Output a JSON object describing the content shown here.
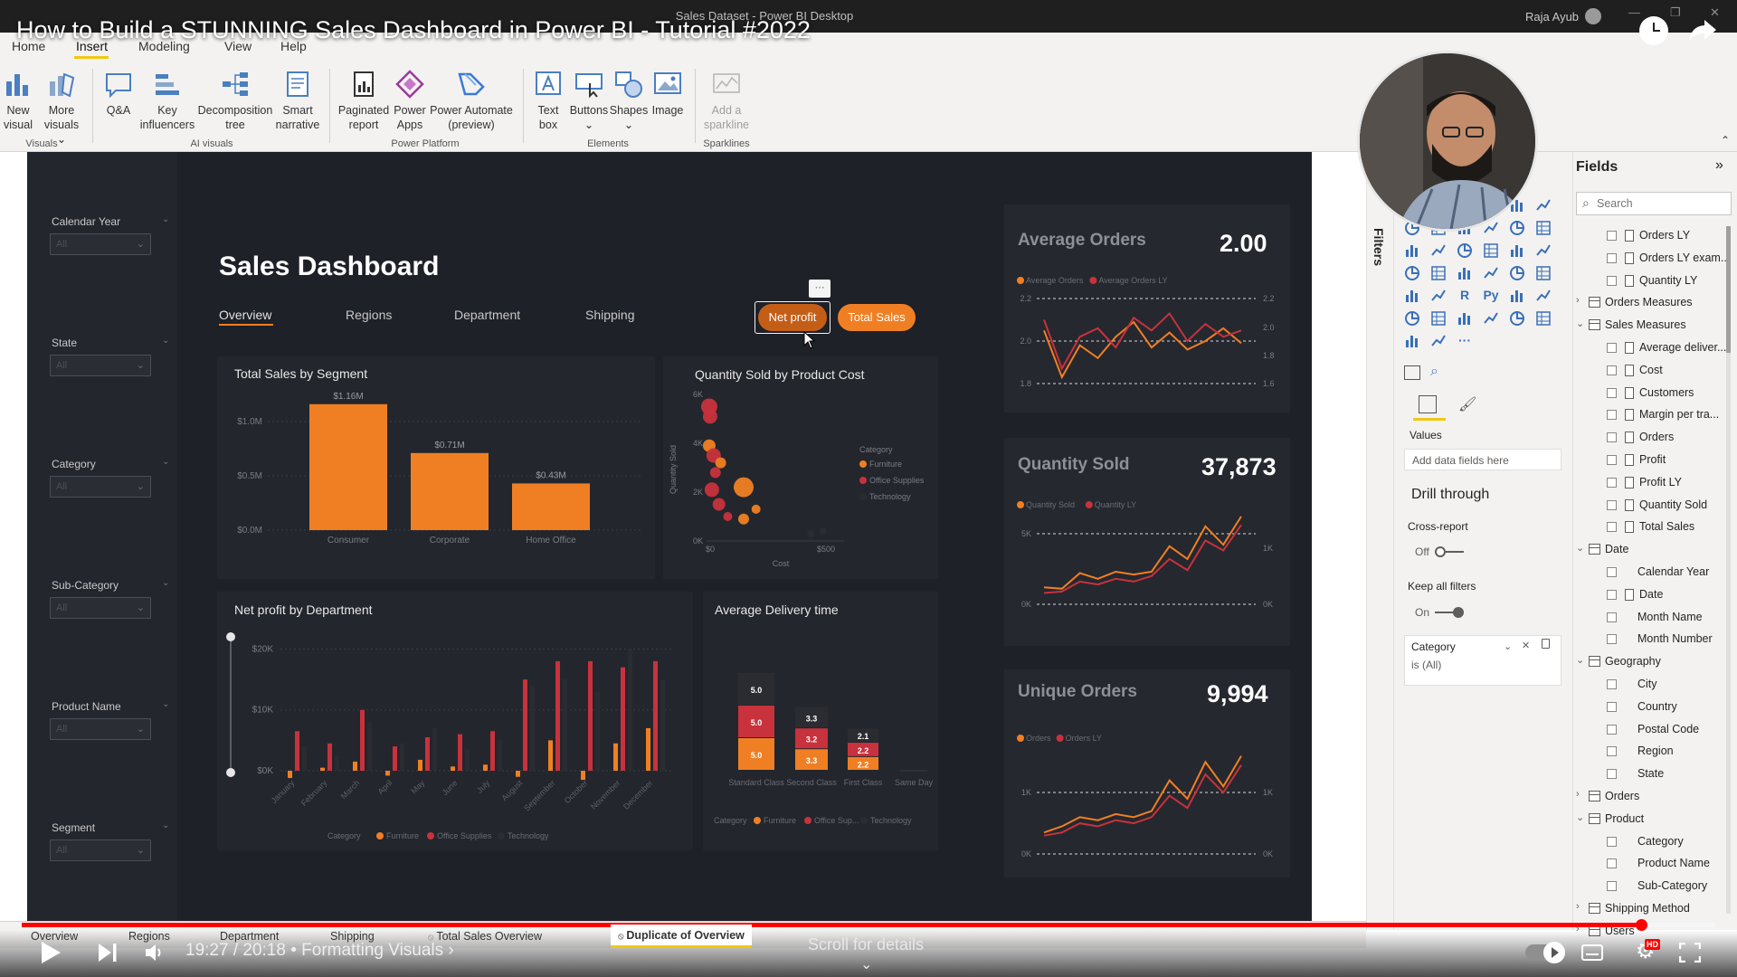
{
  "video": {
    "title": "How to Build a STUNNING Sales Dashboard in Power BI - Tutorial #2022",
    "time": "19:27 / 20:18",
    "chapter": "• Formatting Visuals",
    "chapter_arrow": "›",
    "scroll_hint": "Scroll for details",
    "hd_badge": "HD",
    "progress_fraction": 0.956
  },
  "window": {
    "title": "Sales Dataset - Power BI Desktop",
    "user": "Raja Ayub"
  },
  "ribbon": {
    "tabs": [
      "Home",
      "Insert",
      "Modeling",
      "View",
      "Help"
    ],
    "buttons": {
      "new_visual": [
        "New",
        "visual"
      ],
      "more_visuals": [
        "More",
        "visuals ⌄"
      ],
      "qa": [
        "Q&A",
        ""
      ],
      "key_influencers": [
        "Key",
        "influencers"
      ],
      "decomposition_tree": [
        "Decomposition",
        "tree"
      ],
      "smart_narrative": [
        "Smart",
        "narrative"
      ],
      "paginated_report": [
        "Paginated",
        "report"
      ],
      "power_apps": [
        "Power",
        "Apps"
      ],
      "power_automate": [
        "Power Automate",
        "(preview)"
      ],
      "text_box": [
        "Text",
        "box"
      ],
      "buttons": [
        "Buttons",
        "⌄"
      ],
      "shapes": [
        "Shapes",
        "⌄"
      ],
      "image": [
        "Image",
        ""
      ],
      "add_sparkline": [
        "Add a",
        "sparkline"
      ]
    },
    "groups": [
      "Visuals",
      "AI visuals",
      "Power Platform",
      "Elements",
      "Sparklines"
    ]
  },
  "slicers": [
    {
      "label": "Calendar Year",
      "value": "All"
    },
    {
      "label": "State",
      "value": "All"
    },
    {
      "label": "Category",
      "value": "All"
    },
    {
      "label": "Sub-Category",
      "value": "All"
    },
    {
      "label": "Product Name",
      "value": "All"
    },
    {
      "label": "Segment",
      "value": "All"
    }
  ],
  "dashboard": {
    "title": "Sales Dashboard",
    "nav": [
      "Overview",
      "Regions",
      "Department",
      "Shipping"
    ],
    "toggle_buttons": [
      "Net profit",
      "Total Sales"
    ],
    "more_options": "···"
  },
  "colors": {
    "accent": "#f07f23",
    "furniture": "#f07f23",
    "office_supplies": "#c8323c",
    "technology": "#2a2c31",
    "report_bg": "#1e2128",
    "card_bg": "#23262d",
    "powerbi_yellow": "#f2c811"
  },
  "chart_data": [
    {
      "id": "segment",
      "type": "bar",
      "title": "Total Sales by Segment",
      "categories": [
        "Consumer",
        "Corporate",
        "Home Office"
      ],
      "values": [
        1.16,
        0.71,
        0.43
      ],
      "data_labels": [
        "$1.16M",
        "$0.71M",
        "$0.43M"
      ],
      "y_ticks": [
        "$0.0M",
        "$0.5M",
        "$1.0M"
      ],
      "ylim": [
        0,
        1.2
      ]
    },
    {
      "id": "qty_cost",
      "type": "scatter",
      "title": "Quantity Sold by Product Cost",
      "ylabel": "Quantity Sold",
      "xlabel": "Cost",
      "x_ticks": [
        "$0",
        "$500"
      ],
      "y_ticks": [
        "0K",
        "2K",
        "4K",
        "6K"
      ],
      "xlim": [
        0,
        1000
      ],
      "ylim": [
        0,
        6
      ],
      "legend_title": "Category",
      "legend": [
        "Furniture",
        "Office Supplies",
        "Technology"
      ],
      "points": [
        {
          "x": 15,
          "y": 5.5,
          "s": 9,
          "cat": "Office Supplies"
        },
        {
          "x": 20,
          "y": 5.1,
          "s": 8,
          "cat": "Office Supplies"
        },
        {
          "x": 15,
          "y": 3.9,
          "s": 7,
          "cat": "Furniture"
        },
        {
          "x": 40,
          "y": 3.5,
          "s": 8,
          "cat": "Office Supplies"
        },
        {
          "x": 80,
          "y": 3.2,
          "s": 6,
          "cat": "Furniture"
        },
        {
          "x": 50,
          "y": 2.8,
          "s": 6,
          "cat": "Office Supplies"
        },
        {
          "x": 210,
          "y": 2.2,
          "s": 11,
          "cat": "Furniture"
        },
        {
          "x": 30,
          "y": 2.1,
          "s": 8,
          "cat": "Office Supplies"
        },
        {
          "x": 70,
          "y": 1.5,
          "s": 7,
          "cat": "Office Supplies"
        },
        {
          "x": 120,
          "y": 1.0,
          "s": 5,
          "cat": "Office Supplies"
        },
        {
          "x": 280,
          "y": 1.3,
          "s": 5,
          "cat": "Furniture"
        },
        {
          "x": 210,
          "y": 0.9,
          "s": 6,
          "cat": "Furniture"
        },
        {
          "x": 590,
          "y": 0.3,
          "s": 4,
          "cat": "Technology"
        },
        {
          "x": 660,
          "y": 0.4,
          "s": 4,
          "cat": "Technology"
        }
      ]
    },
    {
      "id": "dept",
      "type": "bar",
      "title": "Net profit by Department",
      "categories": [
        "January",
        "February",
        "March",
        "April",
        "May",
        "June",
        "July",
        "August",
        "September",
        "October",
        "November",
        "December"
      ],
      "y_ticks": [
        "$0K",
        "$10K",
        "$20K"
      ],
      "ylim": [
        0,
        22
      ],
      "legend_title": "Category",
      "legend": [
        "Furniture",
        "Office Supplies",
        "Technology"
      ],
      "series": [
        {
          "name": "Furniture",
          "values": [
            -1.2,
            0.5,
            1.5,
            -0.8,
            1.8,
            0.7,
            1.0,
            -1.0,
            5.0,
            -1.5,
            4.5,
            7.0
          ]
        },
        {
          "name": "Office Supplies",
          "values": [
            6.5,
            4.5,
            10.0,
            4.0,
            5.5,
            6.0,
            6.5,
            15.0,
            18.0,
            18.0,
            17.0,
            18.0
          ]
        },
        {
          "name": "Technology",
          "values": [
            4.0,
            2.5,
            8.0,
            4.5,
            7.0,
            3.5,
            5.0,
            14.0,
            15.0,
            13.0,
            20.0,
            15.0
          ]
        }
      ]
    },
    {
      "id": "delivery",
      "type": "bar",
      "title": "Average Delivery time",
      "categories": [
        "Standard Class",
        "Second Class",
        "First Class",
        "Same Day"
      ],
      "legend_title": "Category",
      "legend": [
        "Furniture",
        "Office Sup...",
        "Technology"
      ],
      "series": [
        {
          "name": "Furniture",
          "values": [
            5.0,
            3.3,
            2.1,
            0
          ]
        },
        {
          "name": "Office Sup...",
          "values": [
            5.0,
            3.2,
            2.2,
            0
          ]
        },
        {
          "name": "Technology",
          "values": [
            5.0,
            3.3,
            2.2,
            0
          ]
        }
      ],
      "data_labels": [
        [
          "5.0",
          "5.0",
          "5.0"
        ],
        [
          "3.3",
          "3.2",
          "3.3"
        ],
        [
          "2.1",
          "2.2",
          "2.2"
        ],
        [
          "",
          "",
          ""
        ]
      ]
    },
    {
      "id": "avg_orders",
      "type": "line",
      "title": "Average Orders",
      "kpi": "2.00",
      "legend": [
        "Average Orders",
        "Average Orders LY"
      ],
      "y_ticks": [
        "1.8",
        "2.0",
        "2.2"
      ],
      "y2_ticks": [
        "1.6",
        "1.8",
        "2.0",
        "2.2"
      ],
      "ylim": [
        1.8,
        2.2
      ],
      "series": [
        {
          "name": "Average Orders",
          "values": [
            2.05,
            1.83,
            1.98,
            1.92,
            2.02,
            2.09,
            1.97,
            2.04,
            1.96,
            2.0,
            2.06,
            1.99
          ]
        },
        {
          "name": "Average Orders LY",
          "values": [
            2.1,
            1.87,
            2.02,
            2.06,
            1.97,
            2.11,
            2.05,
            2.13,
            2.0,
            2.08,
            2.02,
            2.05
          ]
        }
      ]
    },
    {
      "id": "qty_sold",
      "type": "line",
      "title": "Quantity Sold",
      "kpi": "37,873",
      "legend": [
        "Quantity Sold",
        "Quantity LY"
      ],
      "y_ticks": [
        "0K",
        "5K"
      ],
      "y2_ticks": [
        "0K",
        "1K"
      ],
      "ylim": [
        0,
        6
      ],
      "series": [
        {
          "name": "Quantity Sold",
          "values": [
            1.2,
            1.1,
            2.2,
            1.8,
            2.3,
            2.1,
            2.3,
            4.1,
            3.2,
            5.5,
            4.2,
            6.2
          ]
        },
        {
          "name": "Quantity LY",
          "values": [
            0.8,
            0.9,
            1.6,
            1.4,
            1.8,
            1.6,
            2.0,
            3.2,
            2.4,
            4.5,
            3.8,
            5.6
          ]
        }
      ]
    },
    {
      "id": "unique_orders",
      "type": "line",
      "title": "Unique Orders",
      "kpi": "9,994",
      "legend": [
        "Orders",
        "Orders LY"
      ],
      "y_ticks": [
        "0K",
        "1K"
      ],
      "y2_ticks": [
        "0K",
        "1K"
      ],
      "ylim": [
        0,
        1.8
      ],
      "series": [
        {
          "name": "Orders",
          "values": [
            0.35,
            0.45,
            0.6,
            0.55,
            0.65,
            0.6,
            0.7,
            1.2,
            0.9,
            1.5,
            1.1,
            1.6
          ]
        },
        {
          "name": "Orders LY",
          "values": [
            0.3,
            0.35,
            0.5,
            0.45,
            0.55,
            0.5,
            0.6,
            0.95,
            0.75,
            1.3,
            1.0,
            1.45
          ]
        }
      ]
    }
  ],
  "filters_pane": {
    "label": "Filters"
  },
  "viz_pane": {
    "values_label": "Values",
    "add_fields": "Add data fields here",
    "drill_through": "Drill through",
    "cross_report": "Cross-report",
    "cross_report_state": "Off",
    "keep_filters": "Keep all filters",
    "keep_filters_state": "On",
    "filter_card_title": "Category",
    "filter_card_value": "is (All)",
    "icon_glyphs": [
      "R",
      "Py",
      "···"
    ]
  },
  "fields_pane": {
    "title": "Fields",
    "search_placeholder": "Search",
    "rows": [
      {
        "kind": "field",
        "icon": "calc",
        "label": "Orders LY"
      },
      {
        "kind": "field",
        "icon": "calc",
        "label": "Orders LY exam..."
      },
      {
        "kind": "field",
        "icon": "calc",
        "label": "Quantity LY"
      },
      {
        "kind": "table",
        "expanded": false,
        "label": "Orders Measures"
      },
      {
        "kind": "table",
        "expanded": true,
        "label": "Sales Measures"
      },
      {
        "kind": "field",
        "icon": "calc",
        "label": "Average deliver..."
      },
      {
        "kind": "field",
        "icon": "calc",
        "label": "Cost"
      },
      {
        "kind": "field",
        "icon": "calc",
        "label": "Customers"
      },
      {
        "kind": "field",
        "icon": "calc",
        "label": "Margin per tra..."
      },
      {
        "kind": "field",
        "icon": "calc",
        "label": "Orders"
      },
      {
        "kind": "field",
        "icon": "calc",
        "label": "Profit"
      },
      {
        "kind": "field",
        "icon": "calc",
        "label": "Profit LY"
      },
      {
        "kind": "field",
        "icon": "calc",
        "label": "Quantity Sold"
      },
      {
        "kind": "field",
        "icon": "calc",
        "label": "Total Sales"
      },
      {
        "kind": "table",
        "expanded": true,
        "label": "Date"
      },
      {
        "kind": "field",
        "icon": "none",
        "label": "Calendar Year"
      },
      {
        "kind": "field",
        "icon": "hier",
        "label": "Date"
      },
      {
        "kind": "field",
        "icon": "none",
        "label": "Month Name"
      },
      {
        "kind": "field",
        "icon": "none",
        "label": "Month Number"
      },
      {
        "kind": "table",
        "expanded": true,
        "label": "Geography"
      },
      {
        "kind": "field",
        "icon": "none",
        "label": "City"
      },
      {
        "kind": "field",
        "icon": "none",
        "label": "Country"
      },
      {
        "kind": "field",
        "icon": "none",
        "label": "Postal Code"
      },
      {
        "kind": "field",
        "icon": "none",
        "label": "Region"
      },
      {
        "kind": "field",
        "icon": "none",
        "label": "State"
      },
      {
        "kind": "table",
        "expanded": false,
        "label": "Orders"
      },
      {
        "kind": "table",
        "expanded": true,
        "label": "Product"
      },
      {
        "kind": "field",
        "icon": "none",
        "label": "Category"
      },
      {
        "kind": "field",
        "icon": "none",
        "label": "Product Name"
      },
      {
        "kind": "field",
        "icon": "none",
        "label": "Sub-Category"
      },
      {
        "kind": "table",
        "expanded": false,
        "label": "Shipping Method"
      },
      {
        "kind": "table",
        "expanded": false,
        "label": "Users"
      }
    ]
  },
  "page_tabs": [
    {
      "label": "Overview",
      "active": false,
      "hidden": false
    },
    {
      "label": "Regions",
      "active": false,
      "hidden": false
    },
    {
      "label": "Department",
      "active": false,
      "hidden": false
    },
    {
      "label": "Shipping",
      "active": false,
      "hidden": false
    },
    {
      "label": "Total Sales Overview",
      "active": false,
      "hidden": true
    },
    {
      "label": "Duplicate of Overview",
      "active": true,
      "hidden": true
    }
  ],
  "add_page": "+"
}
